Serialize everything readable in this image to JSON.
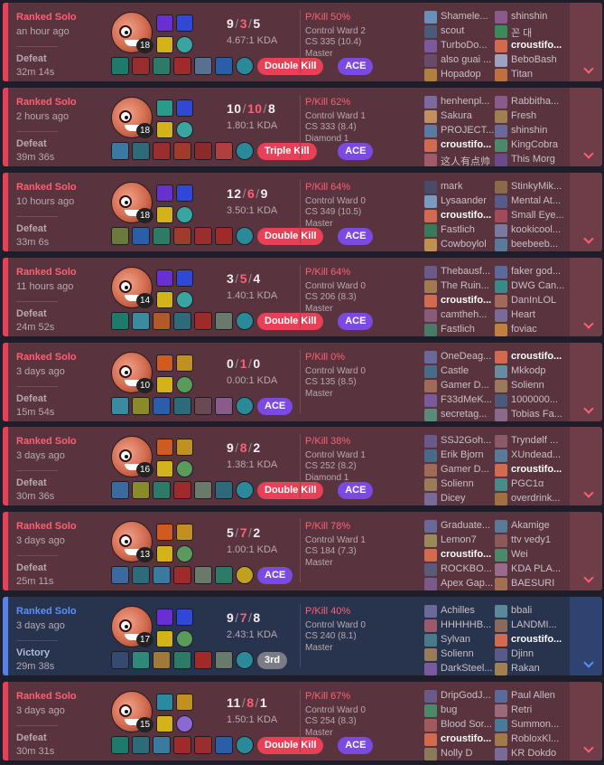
{
  "matches": [
    {
      "result_class": "defeat",
      "queue": "Ranked Solo",
      "time_ago": "an hour ago",
      "result": "Defeat",
      "duration": "32m 14s",
      "level": "18",
      "kills": "9",
      "deaths": "3",
      "assists": "5",
      "kda_ratio": "4.67:1 KDA",
      "badges": [
        {
          "label": "Double Kill",
          "type": "multi"
        },
        {
          "label": "ACE",
          "type": "ace"
        }
      ],
      "p_kill": "P/Kill 50%",
      "control_ward": "Control Ward 2",
      "cs": "CS 335 (10.4)",
      "tier": "Master",
      "spells": [
        "#6a2fd0",
        "#3148d6"
      ],
      "runes": [
        "#d4b21a",
        "#3aa5a0"
      ],
      "items": [
        "#1e7a6a",
        "#9a2e2e",
        "#2d7a66",
        "#a02a2a",
        "#5a7090",
        "#2a5ea8",
        "#2a8a9a"
      ],
      "team1": [
        {
          "name": "Shamele...",
          "color": "#6a8fb8"
        },
        {
          "name": "scout",
          "color": "#4a5a7a"
        },
        {
          "name": "TurboDo...",
          "color": "#7a5a9a"
        },
        {
          "name": "also guai ...",
          "color": "#6a4a6a"
        },
        {
          "name": "Hopadop",
          "color": "#b08040"
        }
      ],
      "team2": [
        {
          "name": "shinshin",
          "color": "#8a5a8a"
        },
        {
          "name": "꼰 대",
          "color": "#3a8a5a"
        },
        {
          "name": "croustifo...",
          "color": "#d16a4e",
          "me": true
        },
        {
          "name": "BeboBash",
          "color": "#a0a0c0"
        },
        {
          "name": "Titan",
          "color": "#c07040"
        }
      ]
    },
    {
      "result_class": "defeat",
      "queue": "Ranked Solo",
      "time_ago": "2 hours ago",
      "result": "Defeat",
      "duration": "39m 36s",
      "level": "18",
      "kills": "10",
      "deaths": "10",
      "assists": "8",
      "kda_ratio": "1.80:1 KDA",
      "badges": [
        {
          "label": "Triple Kill",
          "type": "multi"
        },
        {
          "label": "ACE",
          "type": "ace"
        }
      ],
      "p_kill": "P/Kill 62%",
      "control_ward": "Control Ward 1",
      "cs": "CS 333 (8.4)",
      "tier": "Diamond 1",
      "spells": [
        "#2a9a8a",
        "#3148d6"
      ],
      "runes": [
        "#d4b21a",
        "#3aa5a0"
      ],
      "items": [
        "#3a7aa0",
        "#2d6a7a",
        "#9a2e2e",
        "#a03a2a",
        "#8a2a2a",
        "#b04040",
        "#2a8a9a"
      ],
      "team1": [
        {
          "name": "henhenpl...",
          "color": "#7a6aa0"
        },
        {
          "name": "Sakura",
          "color": "#c09060"
        },
        {
          "name": "PROJECT...",
          "color": "#5a7aa0"
        },
        {
          "name": "croustifo...",
          "color": "#d16a4e",
          "me": true
        },
        {
          "name": "这人有点帅",
          "color": "#a05a6a"
        }
      ],
      "team2": [
        {
          "name": "Rabbitha...",
          "color": "#8a5a8a"
        },
        {
          "name": "Fresh",
          "color": "#a08050"
        },
        {
          "name": "shinshin",
          "color": "#6a6a9a"
        },
        {
          "name": "KingCobra",
          "color": "#4a8a6a"
        },
        {
          "name": "This Morg",
          "color": "#6a4a8a"
        }
      ]
    },
    {
      "result_class": "defeat",
      "queue": "Ranked Solo",
      "time_ago": "10 hours ago",
      "result": "Defeat",
      "duration": "33m 6s",
      "level": "18",
      "kills": "12",
      "deaths": "6",
      "assists": "9",
      "kda_ratio": "3.50:1 KDA",
      "badges": [
        {
          "label": "Double Kill",
          "type": "multi"
        },
        {
          "label": "ACE",
          "type": "ace"
        }
      ],
      "p_kill": "P/Kill 64%",
      "control_ward": "Control Ward 0",
      "cs": "CS 349 (10.5)",
      "tier": "Master",
      "spells": [
        "#6a2fd0",
        "#3148d6"
      ],
      "runes": [
        "#d4b21a",
        "#3aa5a0"
      ],
      "items": [
        "#6a7a3a",
        "#2a5ea8",
        "#2d7a66",
        "#a03a2a",
        "#9a2e2e",
        "#a02a2a",
        "#2a8a9a"
      ],
      "team1": [
        {
          "name": "mark",
          "color": "#4a4a6a"
        },
        {
          "name": "Lysaander",
          "color": "#7a9ac0"
        },
        {
          "name": "croustifo...",
          "color": "#d16a4e",
          "me": true
        },
        {
          "name": "Fastlich",
          "color": "#3a7a5a"
        },
        {
          "name": "Cowboylol",
          "color": "#c09050"
        }
      ],
      "team2": [
        {
          "name": "StinkyMik...",
          "color": "#8a6a4a"
        },
        {
          "name": "Mental At...",
          "color": "#5a5a8a"
        },
        {
          "name": "Small Eye...",
          "color": "#a04a5a"
        },
        {
          "name": "kookicool...",
          "color": "#7a7aa0"
        },
        {
          "name": "beebeeb...",
          "color": "#5a7a9a"
        }
      ]
    },
    {
      "result_class": "defeat",
      "queue": "Ranked Solo",
      "time_ago": "11 hours ago",
      "result": "Defeat",
      "duration": "24m 52s",
      "level": "14",
      "kills": "3",
      "deaths": "5",
      "assists": "4",
      "kda_ratio": "1.40:1 KDA",
      "badges": [
        {
          "label": "Double Kill",
          "type": "multi"
        },
        {
          "label": "ACE",
          "type": "ace"
        }
      ],
      "p_kill": "P/Kill 64%",
      "control_ward": "Control Ward 0",
      "cs": "CS 206 (8.3)",
      "tier": "Master",
      "spells": [
        "#6a2fd0",
        "#3148d6"
      ],
      "runes": [
        "#d4b21a",
        "#3aa5a0"
      ],
      "items": [
        "#1e7a6a",
        "#3a8aa0",
        "#b05a2a",
        "#2d6a7a",
        "#a02a2a",
        "#6a7a6a",
        "#2a8a9a"
      ],
      "team1": [
        {
          "name": "Thebausf...",
          "color": "#6a5a8a"
        },
        {
          "name": "The Ruin...",
          "color": "#a07a50"
        },
        {
          "name": "croustifo...",
          "color": "#d16a4e",
          "me": true
        },
        {
          "name": "camtheh...",
          "color": "#8a5a7a"
        },
        {
          "name": "Fastlich",
          "color": "#4a7a6a"
        }
      ],
      "team2": [
        {
          "name": "faker god...",
          "color": "#5a6a9a"
        },
        {
          "name": "DWG Can...",
          "color": "#3a8a8a"
        },
        {
          "name": "DanInLOL",
          "color": "#a06a5a"
        },
        {
          "name": "Heart",
          "color": "#7a6a9a"
        },
        {
          "name": "foviac",
          "color": "#c08040"
        }
      ]
    },
    {
      "result_class": "defeat",
      "queue": "Ranked Solo",
      "time_ago": "3 days ago",
      "result": "Defeat",
      "duration": "15m 54s",
      "level": "10",
      "kills": "0",
      "deaths": "1",
      "assists": "0",
      "kda_ratio": "0.00:1 KDA",
      "badges": [
        {
          "label": "ACE",
          "type": "ace"
        }
      ],
      "p_kill": "P/Kill 0%",
      "control_ward": "Control Ward 0",
      "cs": "CS 135 (8.5)",
      "tier": "Master",
      "spells": [
        "#d05a20",
        "#c09020"
      ],
      "runes": [
        "#d4b21a",
        "#5a9a5a"
      ],
      "items": [
        "#3a8aa0",
        "#8a8a2a",
        "#2a5ea8",
        "#2d6a7a",
        "#6a4a52",
        "#8a5a8a",
        "#2a8a9a"
      ],
      "team1": [
        {
          "name": "OneDeag...",
          "color": "#6a6a9a"
        },
        {
          "name": "Castle",
          "color": "#4a6a8a"
        },
        {
          "name": "Gamer D...",
          "color": "#a06a5a"
        },
        {
          "name": "F33dMeK...",
          "color": "#7a5a9a"
        },
        {
          "name": "secretag...",
          "color": "#5a8a7a"
        }
      ],
      "team2": [
        {
          "name": "croustifo...",
          "color": "#d16a4e",
          "me": true
        },
        {
          "name": "Mkkodp",
          "color": "#6a8aa0"
        },
        {
          "name": "Solienn",
          "color": "#9a7a5a"
        },
        {
          "name": "1000000...",
          "color": "#4a5a7a"
        },
        {
          "name": "Tobias Fa...",
          "color": "#8a6a8a"
        }
      ]
    },
    {
      "result_class": "defeat",
      "queue": "Ranked Solo",
      "time_ago": "3 days ago",
      "result": "Defeat",
      "duration": "30m 36s",
      "level": "16",
      "kills": "9",
      "deaths": "8",
      "assists": "2",
      "kda_ratio": "1.38:1 KDA",
      "badges": [
        {
          "label": "Double Kill",
          "type": "multi"
        },
        {
          "label": "ACE",
          "type": "ace"
        }
      ],
      "p_kill": "P/Kill 38%",
      "control_ward": "Control Ward 1",
      "cs": "CS 252 (8.2)",
      "tier": "Diamond 1",
      "spells": [
        "#d05a20",
        "#c09020"
      ],
      "runes": [
        "#d4b21a",
        "#5a9a5a"
      ],
      "items": [
        "#3a6aa0",
        "#8a8a2a",
        "#2d7a66",
        "#a02a2a",
        "#6a7a6a",
        "#2d6a7a",
        "#2a8a9a"
      ],
      "team1": [
        {
          "name": "SSJ2Goh...",
          "color": "#6a5a8a"
        },
        {
          "name": "Erik Bjorn",
          "color": "#4a6a8a"
        },
        {
          "name": "Gamer D...",
          "color": "#a06a5a"
        },
        {
          "name": "Solienn",
          "color": "#9a7a5a"
        },
        {
          "name": "Dicey",
          "color": "#7a6a9a"
        }
      ],
      "team2": [
        {
          "name": "Tryndølf ...",
          "color": "#8a5a6a"
        },
        {
          "name": "XUndead...",
          "color": "#5a7a9a"
        },
        {
          "name": "croustifo...",
          "color": "#d16a4e",
          "me": true
        },
        {
          "name": "PGC1α",
          "color": "#4a8a8a"
        },
        {
          "name": "overdrink...",
          "color": "#a07040"
        }
      ]
    },
    {
      "result_class": "defeat",
      "queue": "Ranked Solo",
      "time_ago": "3 days ago",
      "result": "Defeat",
      "duration": "25m 11s",
      "level": "13",
      "kills": "5",
      "deaths": "7",
      "assists": "2",
      "kda_ratio": "1.00:1 KDA",
      "badges": [
        {
          "label": "ACE",
          "type": "ace"
        }
      ],
      "p_kill": "P/Kill 78%",
      "control_ward": "Control Ward 1",
      "cs": "CS 184 (7.3)",
      "tier": "Master",
      "spells": [
        "#d05a20",
        "#c09020"
      ],
      "runes": [
        "#d4b21a",
        "#5a9a5a"
      ],
      "items": [
        "#3a6aa0",
        "#2d6a7a",
        "#3a7aa0",
        "#a02a2a",
        "#6a7a6a",
        "#2d7a66",
        "#c0a020"
      ],
      "team1": [
        {
          "name": "Graduate...",
          "color": "#6a6a9a"
        },
        {
          "name": "Lemon7",
          "color": "#9a8a5a"
        },
        {
          "name": "croustifo...",
          "color": "#d16a4e",
          "me": true
        },
        {
          "name": "ROCKBO...",
          "color": "#5a5a7a"
        },
        {
          "name": "Apex Gap...",
          "color": "#7a5a8a"
        }
      ],
      "team2": [
        {
          "name": "Akamige",
          "color": "#5a7a9a"
        },
        {
          "name": "ttv vedy1",
          "color": "#8a5a5a"
        },
        {
          "name": "Wei",
          "color": "#4a8a6a"
        },
        {
          "name": "KDA PLA...",
          "color": "#9a6a8a"
        },
        {
          "name": "BAESURI",
          "color": "#a07050"
        }
      ]
    },
    {
      "result_class": "victory",
      "queue": "Ranked Solo",
      "time_ago": "3 days ago",
      "result": "Victory",
      "duration": "29m 38s",
      "level": "17",
      "kills": "9",
      "deaths": "7",
      "assists": "8",
      "kda_ratio": "2.43:1 KDA",
      "badges": [
        {
          "label": "3rd",
          "type": "third"
        }
      ],
      "p_kill": "P/Kill 40%",
      "control_ward": "Control Ward 0",
      "cs": "CS 240 (8.1)",
      "tier": "Master",
      "spells": [
        "#6a2fd0",
        "#3148d6"
      ],
      "runes": [
        "#d4b21a",
        "#5a9a5a"
      ],
      "items": [
        "#344a70",
        "#2d8a7a",
        "#a07a3a",
        "#2d7a66",
        "#a02a2a",
        "#6a7a6a",
        "#2a8a9a"
      ],
      "team1": [
        {
          "name": "Achilles",
          "color": "#6a6a9a"
        },
        {
          "name": "HHHHHB...",
          "color": "#9a5a6a"
        },
        {
          "name": "Sylvan",
          "color": "#4a7a8a"
        },
        {
          "name": "Solienn",
          "color": "#9a7a5a"
        },
        {
          "name": "DarkSteel...",
          "color": "#7a5a9a"
        }
      ],
      "team2": [
        {
          "name": "bbali",
          "color": "#5a8a9a"
        },
        {
          "name": "LANDMI...",
          "color": "#8a6a5a"
        },
        {
          "name": "croustifo...",
          "color": "#d16a4e",
          "me": true
        },
        {
          "name": "Djinn",
          "color": "#5a5a8a"
        },
        {
          "name": "Rakan",
          "color": "#a08050"
        }
      ]
    },
    {
      "result_class": "defeat",
      "queue": "Ranked Solo",
      "time_ago": "3 days ago",
      "result": "Defeat",
      "duration": "30m 31s",
      "level": "15",
      "kills": "11",
      "deaths": "8",
      "assists": "1",
      "kda_ratio": "1.50:1 KDA",
      "badges": [
        {
          "label": "Double Kill",
          "type": "multi"
        },
        {
          "label": "ACE",
          "type": "ace"
        }
      ],
      "p_kill": "P/Kill 67%",
      "control_ward": "Control Ward 0",
      "cs": "CS 254 (8.3)",
      "tier": "Master",
      "spells": [
        "#2a8aa0",
        "#c09020"
      ],
      "runes": [
        "#d4b21a",
        "#8a6ad0"
      ],
      "items": [
        "#1e7a6a",
        "#2d6a7a",
        "#3a7aa0",
        "#a02a2a",
        "#9a2e2e",
        "#2a5ea8",
        "#2a8a9a"
      ],
      "team1": [
        {
          "name": "DripGodJ...",
          "color": "#6a5a8a"
        },
        {
          "name": "bug",
          "color": "#4a8a6a"
        },
        {
          "name": "Blood Sor...",
          "color": "#a05a5a"
        },
        {
          "name": "croustifo...",
          "color": "#d16a4e",
          "me": true
        },
        {
          "name": "Nolly D",
          "color": "#8a7a5a"
        }
      ],
      "team2": [
        {
          "name": "Paul Allen",
          "color": "#5a6a9a"
        },
        {
          "name": "Retri",
          "color": "#9a6a7a"
        },
        {
          "name": "Summon...",
          "color": "#4a7a9a"
        },
        {
          "name": "RobloxKl...",
          "color": "#a07a4a"
        },
        {
          "name": "KR Dokdo",
          "color": "#7a6a9a"
        }
      ]
    }
  ]
}
